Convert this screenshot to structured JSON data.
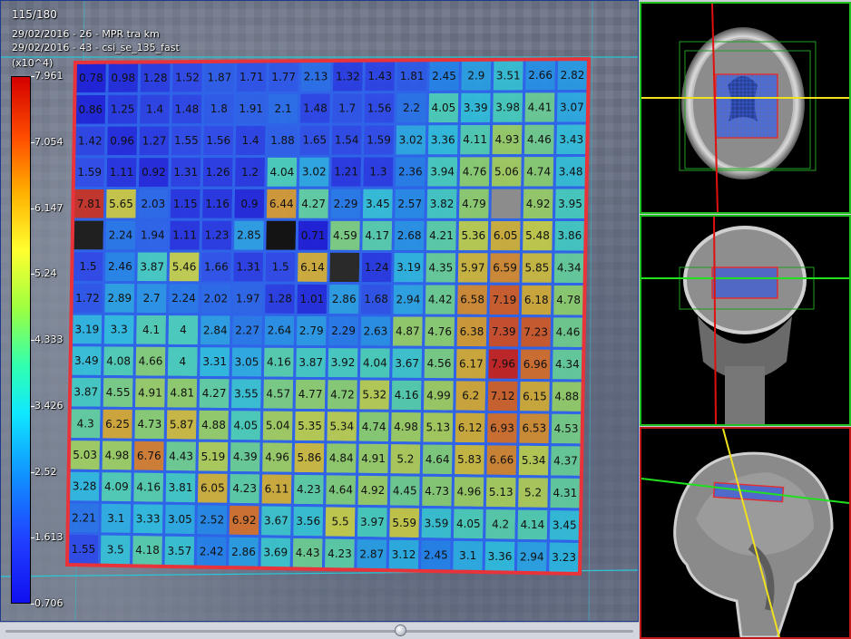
{
  "overlay": {
    "slice_counter": "115/180",
    "series_1": "29/02/2016 - 26 - MPR tra km",
    "series_2": "29/02/2016 - 43 - csi_se_135_fast",
    "scale_unit": "(x10^4)"
  },
  "colorbar": {
    "labels": [
      "7.961",
      "7.054",
      "6.147",
      "5.24",
      "4.333",
      "3.426",
      "2.52",
      "1.613",
      "0.706"
    ]
  },
  "grid": {
    "rows": [
      [
        "0.78",
        "0.98",
        "1.28",
        "1.52",
        "1.87",
        "1.71",
        "1.77",
        "2.13",
        "1.32",
        "1.43",
        "1.81",
        "2.45",
        "2.9",
        "3.51",
        "2.66",
        "2.82"
      ],
      [
        "0.86",
        "1.25",
        "1.4",
        "1.48",
        "1.8",
        "1.91",
        "2.1",
        "1.48",
        "1.7",
        "1.56",
        "2.2",
        "4.05",
        "3.39",
        "3.98",
        "4.41",
        "3.07"
      ],
      [
        "1.42",
        "0.96",
        "1.27",
        "1.55",
        "1.56",
        "1.4",
        "1.88",
        "1.65",
        "1.54",
        "1.59",
        "3.02",
        "3.36",
        "4.11",
        "4.93",
        "4.46",
        "3.43"
      ],
      [
        "1.59",
        "1.11",
        "0.92",
        "1.31",
        "1.26",
        "1.2",
        "4.04",
        "3.02",
        "1.21",
        "1.3",
        "2.36",
        "3.94",
        "4.76",
        "5.06",
        "4.74",
        "3.48"
      ],
      [
        "7.81",
        "5.65",
        "2.03",
        "1.15",
        "1.16",
        "0.9",
        "6.44",
        "4.27",
        "2.29",
        "3.45",
        "2.57",
        "3.82",
        "4.79",
        "",
        "4.92",
        "3.95"
      ],
      [
        "",
        "2.24",
        "1.94",
        "1.11",
        "1.23",
        "2.85",
        "",
        "0.71",
        "4.59",
        "4.17",
        "2.68",
        "4.21",
        "5.36",
        "6.05",
        "5.48",
        "3.86"
      ],
      [
        "1.5",
        "2.46",
        "3.87",
        "5.46",
        "1.66",
        "1.31",
        "1.5",
        "6.14",
        "",
        "1.24",
        "3.19",
        "4.35",
        "5.97",
        "6.59",
        "5.85",
        "4.34"
      ],
      [
        "1.72",
        "2.89",
        "2.7",
        "2.24",
        "2.02",
        "1.97",
        "1.28",
        "1.01",
        "2.86",
        "1.68",
        "2.94",
        "4.42",
        "6.58",
        "7.19",
        "6.18",
        "4.78"
      ],
      [
        "3.19",
        "3.3",
        "4.1",
        "4",
        "2.84",
        "2.27",
        "2.64",
        "2.79",
        "2.29",
        "2.63",
        "4.87",
        "4.76",
        "6.38",
        "7.39",
        "7.23",
        "4.46"
      ],
      [
        "3.49",
        "4.08",
        "4.66",
        "4",
        "3.31",
        "3.05",
        "4.16",
        "3.87",
        "3.92",
        "4.04",
        "3.67",
        "4.56",
        "6.17",
        "7.96",
        "6.96",
        "4.34"
      ],
      [
        "3.87",
        "4.55",
        "4.91",
        "4.81",
        "4.27",
        "3.55",
        "4.57",
        "4.77",
        "4.72",
        "5.32",
        "4.16",
        "4.99",
        "6.2",
        "7.12",
        "6.15",
        "4.88"
      ],
      [
        "4.3",
        "6.25",
        "4.73",
        "5.87",
        "4.88",
        "4.05",
        "5.04",
        "5.35",
        "5.34",
        "4.74",
        "4.98",
        "5.13",
        "6.12",
        "6.93",
        "6.53",
        "4.53"
      ],
      [
        "5.03",
        "4.98",
        "6.76",
        "4.43",
        "5.19",
        "4.39",
        "4.96",
        "5.86",
        "4.84",
        "4.91",
        "5.2",
        "4.64",
        "5.83",
        "6.66",
        "5.34",
        "4.37"
      ],
      [
        "3.28",
        "4.09",
        "4.16",
        "3.81",
        "6.05",
        "4.23",
        "6.11",
        "4.23",
        "4.64",
        "4.92",
        "4.45",
        "4.73",
        "4.96",
        "5.13",
        "5.2",
        "4.31"
      ],
      [
        "2.21",
        "3.1",
        "3.33",
        "3.05",
        "2.52",
        "6.92",
        "3.67",
        "3.56",
        "5.5",
        "3.97",
        "5.59",
        "3.59",
        "4.05",
        "4.2",
        "4.14",
        "3.45"
      ],
      [
        "1.55",
        "3.5",
        "4.18",
        "3.57",
        "2.42",
        "2.86",
        "3.69",
        "4.43",
        "4.23",
        "2.87",
        "3.12",
        "2.45",
        "3.1",
        "3.36",
        "2.94",
        "3.23"
      ]
    ],
    "empty_cells": [
      [
        4,
        13,
        "#8c8c8c"
      ],
      [
        5,
        0,
        "#202020"
      ],
      [
        5,
        6,
        "#141414"
      ],
      [
        6,
        8,
        "#2a2a2a"
      ]
    ],
    "min": 0.706,
    "max": 7.961
  },
  "colors": {
    "roi_border": "#e8333a",
    "cell_border": "#2f63e8",
    "cyan_guide": "#29c8d8",
    "axial_frame": "#20c020",
    "sagittal_frame": "#c01818"
  },
  "side_views": {
    "axial": {
      "frame": "green"
    },
    "coronal": {
      "frame": "green"
    },
    "sagittal": {
      "frame": "red"
    }
  },
  "scrollbar": {
    "position": 0.63
  }
}
